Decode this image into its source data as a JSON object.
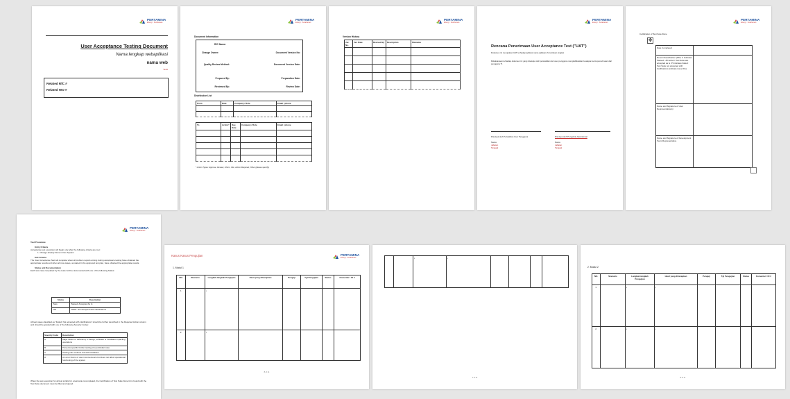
{
  "logo": {
    "name": "PERTAMINA",
    "tagline": "Energi · Ketahanan"
  },
  "page1": {
    "title": "User Acceptance Testing Document",
    "app_name": "Nama lengkap webaplikasi",
    "web": "nama web",
    "version": "Versi",
    "related_rfc": "Related RfC #",
    "related_wo": "Related WO #"
  },
  "page2": {
    "doc_info_heading": "Document Information",
    "rfc_label": "RfC Name:",
    "change_owner": "Change Owner:",
    "doc_version": "Document Version No:",
    "quality_review": "Quality Review Method:",
    "doc_version_date": "Document Version Date:",
    "prepared_by": "Prepared By:",
    "preparation_date": "Preparation Date:",
    "reviewed_by": "Reviewed By:",
    "review_date": "Review Date:",
    "dist_heading": "Distribution List",
    "dist_cols": [
      "From",
      "Date",
      "Company / Role",
      "Email / phone"
    ],
    "to_cols": [
      "To",
      "Action*",
      "Due Date",
      "Company / Role",
      "Email / phone"
    ],
    "footnote": "* Action Types: Approve, Review, Inform, File, Action Required, Other (please specify)"
  },
  "page3": {
    "heading": "Version History",
    "cols": [
      "Ver. No.",
      "Ver. Date",
      "Revised By",
      "Description",
      "Filename"
    ]
  },
  "page4": {
    "title": "Rencana Penerimaan User Acceptance Test (\"UAT\")",
    "subtitle": "Dokumen ini merupakan UAT terhadap aplikasi nama aplikasi, Peruntukan singkat",
    "body": "Pelaksanaan terhadap dokumen ini yang disetujui oleh perwakilan dari user pengguna mengindikasikan kesiapan serta penerimaan dari pengguna TI.",
    "sign_left": "Disetujui oleh Perwakilan User Pengguna",
    "sign_right": "Disetujui oleh Pengelola Operational",
    "name": "Nama",
    "jabatan": "Jabatan",
    "tanggal": "Tanggal"
  },
  "page5": {
    "heading": "Certification of Test Suite Done",
    "rows": [
      "Date Completed",
      "Result Classification (F/P): F Indicates Passed - All tests in Test Suite are accepted as is. P Indicates Failed: Test Suite not accepted with clarifications (indicate issue IDs)",
      "Name and Signature of User Representative(s)",
      "Name and Signature of Development Team Representative"
    ]
  },
  "page6": {
    "test_procedure": "Test Procedure",
    "entry_criteria": "Entry Criteria",
    "entry_text": "Acceptance test execution will begin only after the following criteria are met:",
    "entry_item": "1.  Change already Done in Dev System",
    "exit_criteria": "Exit Criteria",
    "exit_text": "The User Acceptance Test will complete when all problem reports arising during acceptance testing have obtained the appropriate results and when all new cases, as stated in the approved test plan, have obtained the appropriate results.",
    "status_heading": "Status and Documentation",
    "status_text": "Each test case completed by the tester will be documented with one of the following Status:",
    "status_cols": [
      "Status",
      "Description"
    ],
    "status_rows": [
      [
        "Pass",
        "Passed. Accepted As Is"
      ],
      [
        "Fail",
        "Failed. Not accepted with clarifications"
      ]
    ],
    "severity_text": "All test cases classified as \"Failed: Not accepted with clarifications\" should be further described in the Required Action column and should be graded with one of the following Severity Codes:",
    "severity_cols": [
      "Severity Code",
      "Description"
    ],
    "severity_rows": [
      [
        "A",
        "Major defect or deficiency in design, software or hardware impacting operations"
      ],
      [
        "B",
        "Prevents specific further testing of a particular case"
      ],
      [
        "C",
        "Testing can continue but with limitations"
      ],
      [
        "D",
        "An error that is of user inconvenience but does not affect operational functioning of the system"
      ]
    ],
    "closing": "When the test execution for all test scripts for a test suite is completed, the Certification of Test Suite Done form found with the Test Suite document must be filled and signed."
  },
  "page7": {
    "heading": "Kasus Kasus Pengujian",
    "module": "1.   Modul 1",
    "cols": [
      "NO.",
      "Skenario",
      "Langkah-langkah Pengujian",
      "Hasil yang diharapkan",
      "Penguji",
      "Tgl Pengujian",
      "Status",
      "Komentar / ID #"
    ],
    "row_nums": [
      "1.",
      "2."
    ],
    "footer": "8 of 11"
  },
  "page8": {
    "footer": "1 of 11"
  },
  "page9": {
    "module": "2.   Modul 2",
    "cols": [
      "NO.",
      "Skenario",
      "Langkah-langkah Pengujian",
      "Hasil yang diharapkan",
      "Penguji",
      "Tgl Pengujian",
      "Status",
      "Komentar / ID #"
    ],
    "row_nums": [
      "1.",
      "2."
    ],
    "footer": "8 of 11"
  }
}
